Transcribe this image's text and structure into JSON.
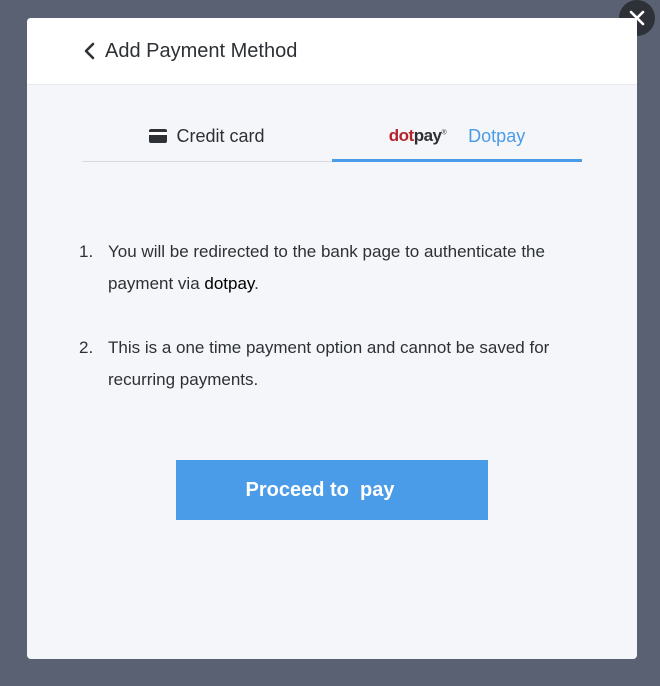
{
  "header": {
    "title": "Add Payment Method",
    "back_icon": "chevron-left-icon"
  },
  "tabs": [
    {
      "label": "Credit card",
      "icon": "credit-card-icon",
      "active": false
    },
    {
      "label": "Dotpay",
      "icon": "dotpay-logo",
      "active": true
    }
  ],
  "dotpay_logo": {
    "dot": "dot",
    "pay": "pay",
    "mark": "®"
  },
  "steps": [
    {
      "number": "1.",
      "text": "You will be redirected to the bank page to authenticate the payment via ",
      "brand": "dotpay",
      "suffix": "."
    },
    {
      "number": "2.",
      "text": "This is a one time payment option and cannot be saved for recurring payments.",
      "brand": "",
      "suffix": ""
    }
  ],
  "proceed_label": "Proceed to  pay",
  "close_icon": "close-icon",
  "colors": {
    "accent": "#4a9be8",
    "overlay": "#5a6173",
    "dotpay_red": "#b5232b"
  }
}
